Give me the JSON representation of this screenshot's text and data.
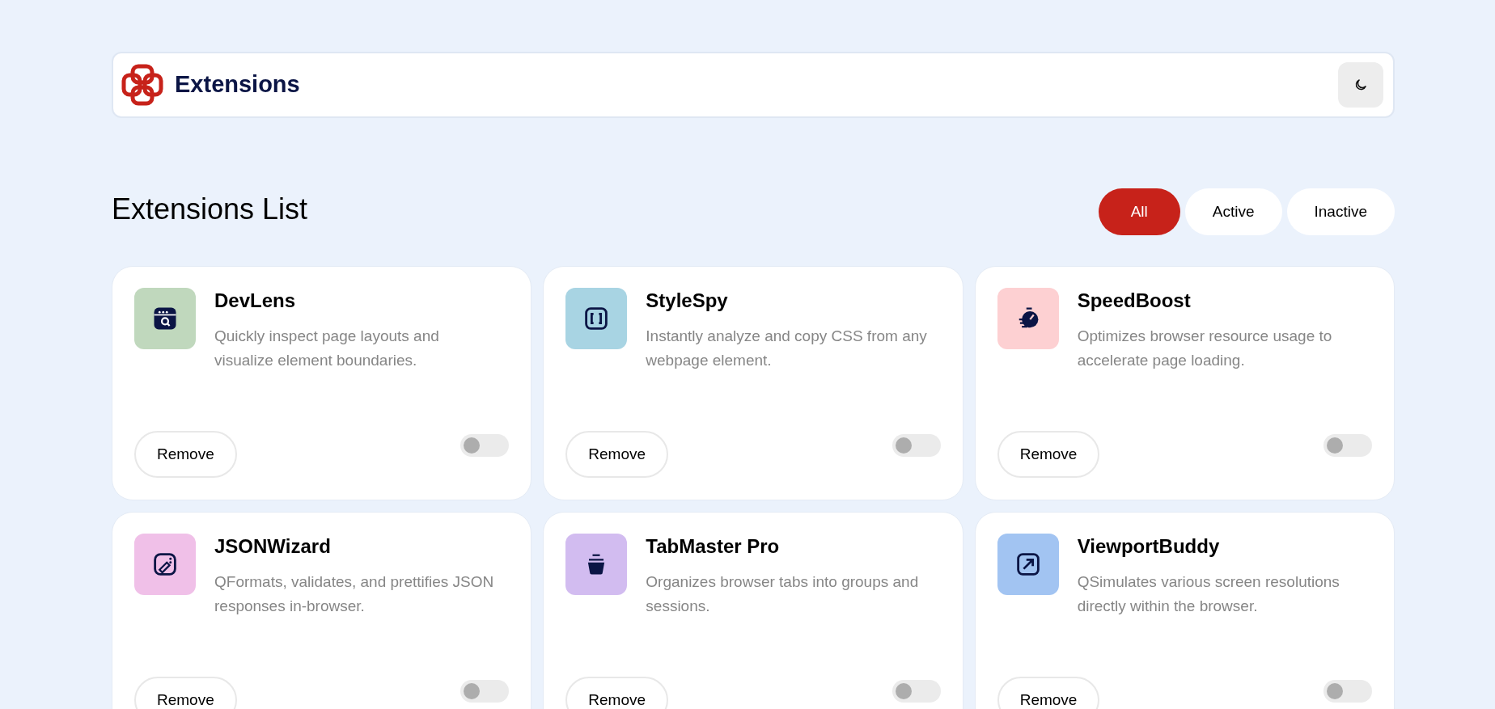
{
  "header": {
    "title": "Extensions"
  },
  "section": {
    "title": "Extensions List"
  },
  "filters": [
    {
      "label": "All",
      "selected": true
    },
    {
      "label": "Active",
      "selected": false
    },
    {
      "label": "Inactive",
      "selected": false
    }
  ],
  "extensions": [
    {
      "kind": "inspector",
      "name": "DevLens",
      "description": "Quickly inspect page layouts and visualize element boundaries.",
      "color": "#c0d8bd",
      "button": "Remove",
      "on": false
    },
    {
      "kind": "brackets",
      "name": "StyleSpy",
      "description": "Instantly analyze and copy CSS from any webpage element.",
      "color": "#a8d4e3",
      "button": "Remove",
      "on": false
    },
    {
      "kind": "stopwatch",
      "name": "SpeedBoost",
      "description": "Optimizes browser resource usage to accelerate page loading.",
      "color": "#fdd0d2",
      "button": "Remove",
      "on": false
    },
    {
      "kind": "image",
      "name": "JSONWizard",
      "description": "QFormats, validates, and prettifies JSON responses in-browser.",
      "color": "#f0c0e8",
      "button": "Remove",
      "on": false
    },
    {
      "kind": "pot",
      "name": "TabMaster Pro",
      "description": "Organizes browser tabs into groups and sessions.",
      "color": "#d2bcf0",
      "button": "Remove",
      "on": false
    },
    {
      "kind": "resize",
      "name": "ViewportBuddy",
      "description": "QSimulates various screen resolutions directly within the browser.",
      "color": "#a2c4f2",
      "button": "Remove",
      "on": false
    }
  ]
}
